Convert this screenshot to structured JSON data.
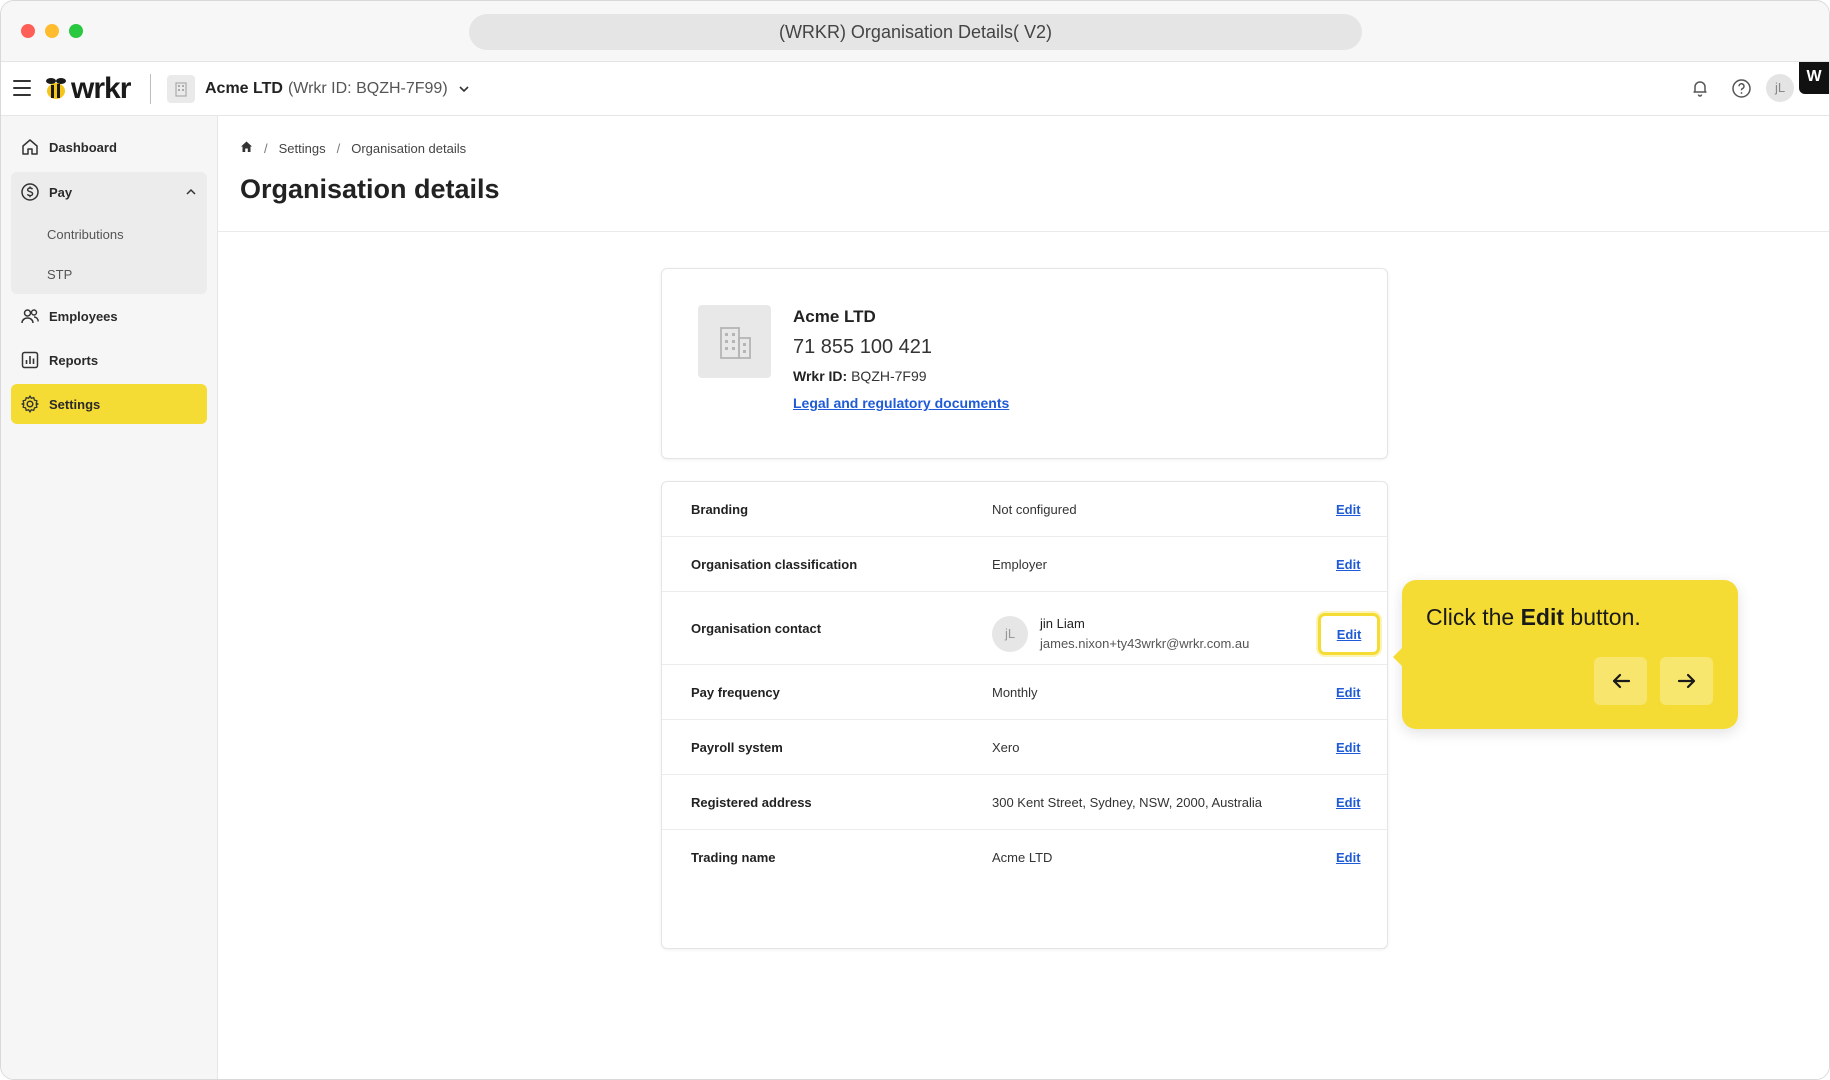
{
  "window": {
    "title": "(WRKR) Organisation Details( V2)"
  },
  "header": {
    "logo_text": "wrkr",
    "org_name": "Acme LTD",
    "org_id": "(Wrkr ID: BQZH-7F99)",
    "user_initials": "jL",
    "badge": "W"
  },
  "sidebar": {
    "items": [
      {
        "label": "Dashboard",
        "icon": "home-icon"
      },
      {
        "label": "Pay",
        "icon": "dollar-circle-icon"
      },
      {
        "label": "Employees",
        "icon": "users-icon"
      },
      {
        "label": "Reports",
        "icon": "bar-chart-icon"
      },
      {
        "label": "Settings",
        "icon": "gear-icon"
      }
    ],
    "pay_subitems": [
      {
        "label": "Contributions"
      },
      {
        "label": "STP"
      }
    ],
    "active": "Settings"
  },
  "breadcrumb": {
    "items": [
      "Settings",
      "Organisation details"
    ]
  },
  "page": {
    "title": "Organisation details"
  },
  "org_card": {
    "name": "Acme LTD",
    "abn": "71 855 100 421",
    "wrkr_id_label": "Wrkr ID:",
    "wrkr_id": "BQZH-7F99",
    "link": "Legal and regulatory documents"
  },
  "details": {
    "edit_label": "Edit",
    "rows": [
      {
        "label": "Branding",
        "value": "Not configured"
      },
      {
        "label": "Organisation classification",
        "value": "Employer"
      },
      {
        "label": "Organisation contact",
        "contact_initials": "jL",
        "contact_name": "jin Liam",
        "contact_email": "james.nixon+ty43wrkr@wrkr.com.au"
      },
      {
        "label": "Pay frequency",
        "value": "Monthly"
      },
      {
        "label": "Payroll system",
        "value": "Xero"
      },
      {
        "label": "Registered address",
        "value": "300 Kent Street, Sydney, NSW, 2000, Australia"
      },
      {
        "label": "Trading name",
        "value": "Acme LTD"
      }
    ]
  },
  "tooltip": {
    "text_before": "Click the ",
    "text_bold": "Edit",
    "text_after": " button.",
    "accent": "#f5dc35"
  }
}
